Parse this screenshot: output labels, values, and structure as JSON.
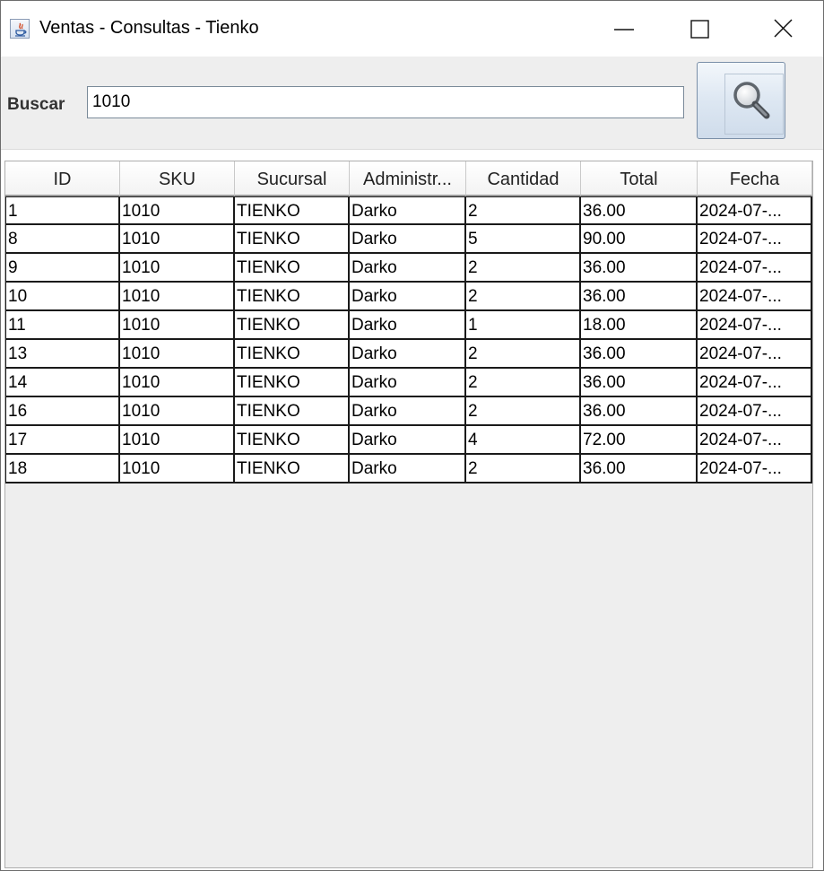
{
  "window": {
    "title": "Ventas - Consultas - Tienko",
    "icon": "java-app-icon",
    "controls": [
      "minimize-icon",
      "maximize-icon",
      "close-icon"
    ]
  },
  "search": {
    "label": "Buscar",
    "value": "1010",
    "button_icon": "magnifier-icon"
  },
  "table": {
    "columns": [
      "ID",
      "SKU",
      "Sucursal",
      "Administr...",
      "Cantidad",
      "Total",
      "Fecha"
    ],
    "rows": [
      [
        "1",
        "1010",
        "TIENKO",
        "Darko",
        "2",
        "36.00",
        "2024-07-..."
      ],
      [
        "8",
        "1010",
        "TIENKO",
        "Darko",
        "5",
        "90.00",
        "2024-07-..."
      ],
      [
        "9",
        "1010",
        "TIENKO",
        "Darko",
        "2",
        "36.00",
        "2024-07-..."
      ],
      [
        "10",
        "1010",
        "TIENKO",
        "Darko",
        "2",
        "36.00",
        "2024-07-..."
      ],
      [
        "11",
        "1010",
        "TIENKO",
        "Darko",
        "1",
        "18.00",
        "2024-07-..."
      ],
      [
        "13",
        "1010",
        "TIENKO",
        "Darko",
        "2",
        "36.00",
        "2024-07-..."
      ],
      [
        "14",
        "1010",
        "TIENKO",
        "Darko",
        "2",
        "36.00",
        "2024-07-..."
      ],
      [
        "16",
        "1010",
        "TIENKO",
        "Darko",
        "2",
        "36.00",
        "2024-07-..."
      ],
      [
        "17",
        "1010",
        "TIENKO",
        "Darko",
        "4",
        "72.00",
        "2024-07-..."
      ],
      [
        "18",
        "1010",
        "TIENKO",
        "Darko",
        "2",
        "36.00",
        "2024-07-..."
      ]
    ]
  }
}
